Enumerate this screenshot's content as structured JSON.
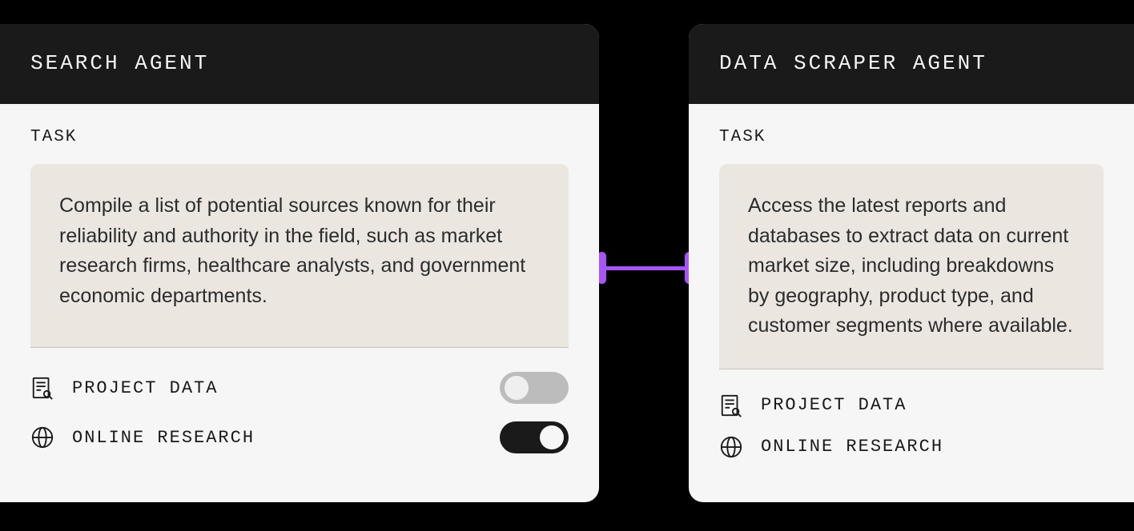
{
  "connector_color": "#a855f7",
  "cards": [
    {
      "title": "SEARCH AGENT",
      "task_label": "TASK",
      "task_text": "Compile a list of potential sources known for their reliability and authority in the field, such as market research firms, healthcare analysts, and government economic departments.",
      "options": [
        {
          "icon": "document-search-icon",
          "label": "PROJECT DATA",
          "toggle_on": false,
          "toggle_visible": true
        },
        {
          "icon": "globe-icon",
          "label": "ONLINE RESEARCH",
          "toggle_on": true,
          "toggle_visible": true
        }
      ]
    },
    {
      "title": "DATA SCRAPER AGENT",
      "task_label": "TASK",
      "task_text": "Access the latest reports and databases to extract data on current market size, including breakdowns by geography, product type, and customer segments where available.",
      "options": [
        {
          "icon": "document-search-icon",
          "label": "PROJECT DATA",
          "toggle_on": false,
          "toggle_visible": false
        },
        {
          "icon": "globe-icon",
          "label": "ONLINE RESEARCH",
          "toggle_on": false,
          "toggle_visible": false
        }
      ]
    }
  ]
}
